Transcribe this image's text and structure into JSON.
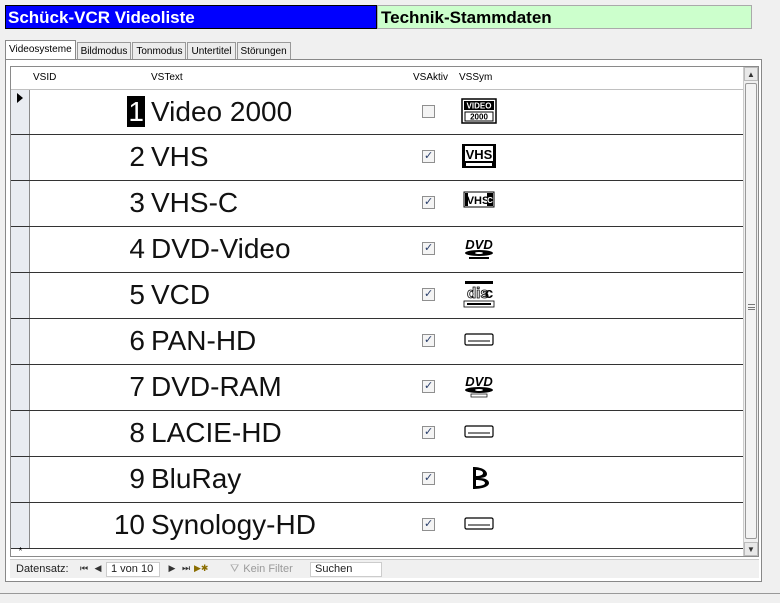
{
  "header": {
    "title_left": "Schück-VCR Videoliste",
    "title_right": "Technik-Stammdaten",
    "colors": {
      "title_left_bg": "#0000ff",
      "title_right_bg": "#ccffcc"
    }
  },
  "tabs": [
    {
      "label": "Videosysteme",
      "active": true
    },
    {
      "label": "Bildmodus",
      "active": false
    },
    {
      "label": "Tonmodus",
      "active": false
    },
    {
      "label": "Untertitel",
      "active": false
    },
    {
      "label": "Störungen",
      "active": false
    }
  ],
  "grid": {
    "columns": {
      "vsid": "VSID",
      "vstext": "VSText",
      "vsaktiv": "VSAktiv",
      "vssym": "VSSym"
    },
    "rows": [
      {
        "id": "1",
        "text": "Video 2000",
        "active": false,
        "symbol": "video2000-logo-icon"
      },
      {
        "id": "2",
        "text": "VHS",
        "active": true,
        "symbol": "vhs-logo-icon"
      },
      {
        "id": "3",
        "text": "VHS-C",
        "active": true,
        "symbol": "vhsc-logo-icon"
      },
      {
        "id": "4",
        "text": "DVD-Video",
        "active": true,
        "symbol": "dvd-video-logo-icon"
      },
      {
        "id": "5",
        "text": "VCD",
        "active": true,
        "symbol": "compact-disc-logo-icon"
      },
      {
        "id": "6",
        "text": "PAN-HD",
        "active": true,
        "symbol": "hard-disk-icon"
      },
      {
        "id": "7",
        "text": "DVD-RAM",
        "active": true,
        "symbol": "dvd-ram-logo-icon"
      },
      {
        "id": "8",
        "text": "LACIE-HD",
        "active": true,
        "symbol": "hard-disk-icon"
      },
      {
        "id": "9",
        "text": "BluRay",
        "active": true,
        "symbol": "bluray-logo-icon"
      },
      {
        "id": "10",
        "text": "Synology-HD",
        "active": true,
        "symbol": "hard-disk-icon"
      }
    ],
    "new_row_marker": "*"
  },
  "navigation": {
    "label": "Datensatz:",
    "position": "1 von 10",
    "filter_label": "Kein Filter",
    "search_placeholder": "Suchen",
    "first_glyph": "⏮",
    "prev_glyph": "◀",
    "next_glyph": "▶",
    "last_glyph": "⏭",
    "new_glyph": "▶✱"
  }
}
